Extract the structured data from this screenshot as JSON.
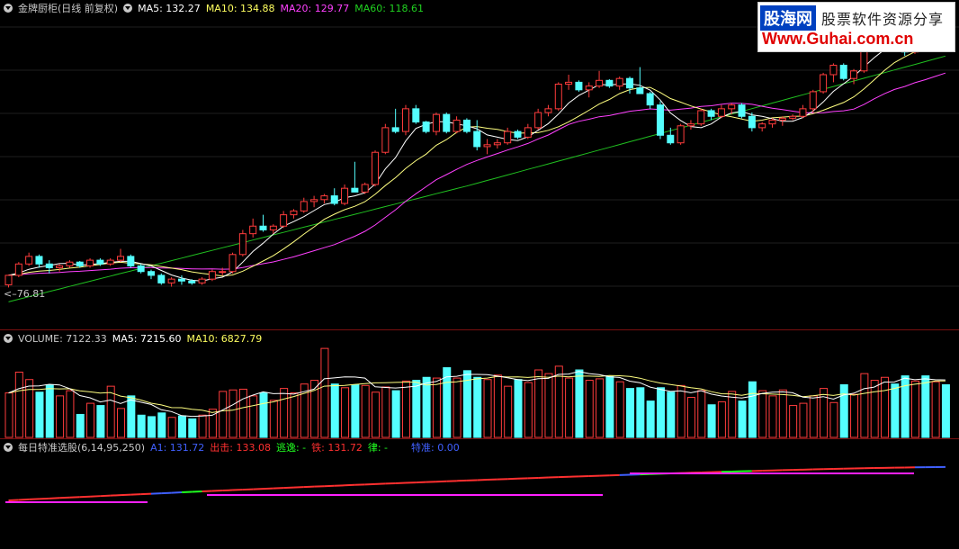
{
  "main": {
    "title": "金牌厨柜(日线 前复权)",
    "ma5": "MA5: 132.27",
    "ma10": "MA10: 134.88",
    "ma20": "MA20: 129.77",
    "ma60": "MA60: 118.61",
    "low_label": "76.81"
  },
  "volume": {
    "title": "VOLUME: 7122.33",
    "ma5": "MA5: 7215.60",
    "ma10": "MA10: 6827.79"
  },
  "indicator": {
    "title": "每日特准选股(6,14,95,250)",
    "a1": "A1: 131.72",
    "chuji": "出击: 133.08",
    "taoyi": "逃逸: -",
    "tie": "铁: 131.72",
    "lv": "律: -",
    "tezhun": "特准: 0.00"
  },
  "watermark": {
    "brand": "股海网",
    "slogan": "股票软件资源分享",
    "url": "Www.Guhai.com.cn"
  },
  "colors": {
    "up": "#ff3c3c",
    "down": "#54ffff",
    "ma5": "#ffffff",
    "ma10": "#ffff80",
    "ma20": "#ff40ff",
    "ma60": "#20c020",
    "a1": "#4060ff",
    "chuji": "#ff3030",
    "taoyi": "#20ff20",
    "tie": "#ff3030",
    "lv": "#20ff20",
    "tezhun": "#4060ff"
  },
  "chart_data": {
    "type": "candlestick",
    "candles": [
      [
        77.5,
        80.2,
        76.8,
        80.0
      ],
      [
        80.0,
        83.5,
        79.5,
        83.0
      ],
      [
        83.0,
        86.0,
        82.5,
        85.0
      ],
      [
        85.0,
        85.5,
        82.0,
        83.0
      ],
      [
        83.0,
        84.0,
        80.5,
        82.0
      ],
      [
        82.0,
        83.0,
        81.0,
        82.5
      ],
      [
        82.5,
        84.0,
        82.0,
        83.5
      ],
      [
        83.5,
        83.8,
        82.0,
        82.5
      ],
      [
        82.5,
        84.5,
        82.0,
        84.0
      ],
      [
        84.0,
        84.5,
        82.5,
        83.0
      ],
      [
        83.0,
        84.5,
        82.5,
        84.0
      ],
      [
        84.0,
        87.0,
        83.5,
        85.0
      ],
      [
        85.0,
        85.5,
        82.0,
        82.5
      ],
      [
        82.5,
        83.0,
        80.5,
        81.0
      ],
      [
        81.0,
        81.5,
        79.0,
        80.0
      ],
      [
        80.0,
        80.5,
        77.5,
        78.0
      ],
      [
        78.0,
        79.5,
        77.0,
        79.0
      ],
      [
        79.0,
        80.0,
        77.5,
        78.5
      ],
      [
        78.5,
        79.0,
        77.5,
        78.0
      ],
      [
        78.0,
        79.5,
        77.5,
        79.0
      ],
      [
        79.0,
        81.5,
        78.5,
        81.0
      ],
      [
        81.0,
        82.0,
        80.0,
        81.0
      ],
      [
        81.0,
        86.0,
        80.5,
        85.5
      ],
      [
        85.5,
        92.0,
        85.0,
        91.0
      ],
      [
        91.0,
        95.0,
        90.0,
        93.0
      ],
      [
        93.0,
        96.0,
        91.5,
        92.0
      ],
      [
        92.0,
        93.5,
        91.0,
        93.0
      ],
      [
        93.0,
        97.0,
        92.5,
        96.0
      ],
      [
        96.0,
        97.5,
        95.0,
        97.0
      ],
      [
        97.0,
        100.5,
        96.5,
        99.5
      ],
      [
        99.5,
        101.0,
        98.0,
        100.0
      ],
      [
        100.0,
        101.5,
        99.0,
        101.0
      ],
      [
        101.0,
        103.0,
        98.5,
        99.0
      ],
      [
        99.0,
        104.0,
        98.5,
        103.0
      ],
      [
        103.0,
        110.0,
        102.5,
        102.0
      ],
      [
        102.0,
        104.5,
        101.5,
        104.0
      ],
      [
        104.0,
        113.0,
        103.5,
        112.5
      ],
      [
        112.5,
        120.0,
        112.0,
        119.0
      ],
      [
        119.0,
        124.0,
        117.5,
        118.0
      ],
      [
        118.0,
        125.0,
        117.0,
        124.0
      ],
      [
        124.0,
        125.0,
        120.0,
        120.5
      ],
      [
        120.5,
        120.8,
        117.5,
        118.0
      ],
      [
        118.0,
        123.0,
        117.0,
        122.5
      ],
      [
        122.5,
        123.0,
        117.5,
        118.0
      ],
      [
        118.0,
        122.0,
        117.5,
        121.0
      ],
      [
        121.0,
        121.5,
        117.5,
        118.0
      ],
      [
        118.0,
        121.0,
        113.0,
        114.0
      ],
      [
        114.0,
        116.0,
        112.0,
        114.5
      ],
      [
        114.5,
        116.0,
        113.5,
        115.0
      ],
      [
        115.0,
        119.0,
        114.5,
        118.0
      ],
      [
        118.0,
        118.5,
        116.0,
        116.5
      ],
      [
        116.5,
        120.0,
        116.0,
        119.0
      ],
      [
        119.0,
        124.0,
        118.5,
        123.0
      ],
      [
        123.0,
        125.0,
        122.0,
        124.0
      ],
      [
        124.0,
        131.0,
        123.5,
        130.5
      ],
      [
        130.5,
        133.0,
        129.0,
        131.0
      ],
      [
        131.0,
        131.5,
        128.5,
        129.0
      ],
      [
        129.0,
        131.0,
        127.0,
        130.0
      ],
      [
        130.0,
        134.0,
        129.5,
        131.5
      ],
      [
        131.5,
        131.8,
        129.5,
        130.0
      ],
      [
        130.0,
        132.5,
        129.0,
        132.0
      ],
      [
        132.0,
        132.5,
        128.0,
        129.5
      ],
      [
        129.5,
        135.0,
        128.5,
        128.0
      ],
      [
        128.0,
        128.5,
        124.0,
        125.0
      ],
      [
        125.0,
        126.0,
        116.0,
        117.0
      ],
      [
        117.0,
        119.0,
        114.5,
        115.0
      ],
      [
        115.0,
        120.0,
        114.5,
        119.5
      ],
      [
        119.5,
        121.0,
        118.5,
        120.0
      ],
      [
        120.0,
        124.0,
        119.5,
        123.5
      ],
      [
        123.5,
        124.0,
        121.0,
        122.0
      ],
      [
        122.0,
        125.0,
        121.5,
        124.0
      ],
      [
        124.0,
        125.5,
        122.5,
        125.0
      ],
      [
        125.0,
        125.5,
        121.5,
        122.0
      ],
      [
        122.0,
        123.0,
        118.0,
        119.0
      ],
      [
        119.0,
        120.5,
        118.0,
        120.0
      ],
      [
        120.0,
        121.5,
        119.0,
        121.0
      ],
      [
        121.0,
        122.0,
        119.5,
        121.5
      ],
      [
        121.5,
        122.5,
        121.0,
        122.0
      ],
      [
        122.0,
        125.0,
        121.5,
        124.0
      ],
      [
        124.0,
        129.0,
        123.0,
        128.5
      ],
      [
        128.5,
        133.5,
        128.0,
        133.0
      ],
      [
        133.0,
        136.0,
        131.0,
        135.5
      ],
      [
        135.5,
        136.0,
        131.5,
        132.0
      ],
      [
        132.0,
        134.5,
        130.5,
        134.0
      ],
      [
        134.0,
        142.0,
        133.5,
        141.0
      ],
      [
        141.0,
        146.0,
        140.0,
        145.0
      ],
      [
        145.0,
        147.5,
        143.0,
        146.0
      ],
      [
        146.0,
        147.0,
        142.0,
        143.0
      ],
      [
        143.0,
        145.0,
        138.0,
        139.0
      ],
      [
        139.0,
        143.0,
        138.5,
        142.0
      ],
      [
        142.0,
        142.5,
        139.0,
        140.0
      ],
      [
        140.0,
        143.0,
        139.5,
        142.5
      ],
      [
        142.5,
        143.0,
        139.0,
        139.5
      ]
    ],
    "volumes": [
      6000,
      8800,
      7800,
      6100,
      7100,
      5600,
      6300,
      3100,
      4600,
      4300,
      6900,
      3900,
      5600,
      3000,
      2800,
      3300,
      2700,
      2900,
      2500,
      3000,
      3800,
      6200,
      6400,
      6500,
      5600,
      6000,
      5000,
      6600,
      6000,
      7200,
      7700,
      12000,
      7200,
      6700,
      7100,
      7000,
      6100,
      6800,
      6300,
      7600,
      7700,
      8100,
      8000,
      9400,
      8000,
      9000,
      8100,
      7800,
      8400,
      6900,
      7800,
      7400,
      9100,
      8600,
      9600,
      8000,
      9100,
      7700,
      7900,
      8200,
      7500,
      6600,
      6700,
      4900,
      6700,
      6100,
      7000,
      5400,
      6300,
      4400,
      4800,
      6200,
      4900,
      7500,
      6300,
      5600,
      6400,
      4300,
      4600,
      5600,
      6600,
      4700,
      7100,
      5800,
      8600,
      7700,
      8100,
      7200,
      8300,
      7600,
      8300,
      7500,
      7100
    ],
    "ylim": [
      76.81,
      147.5
    ]
  }
}
